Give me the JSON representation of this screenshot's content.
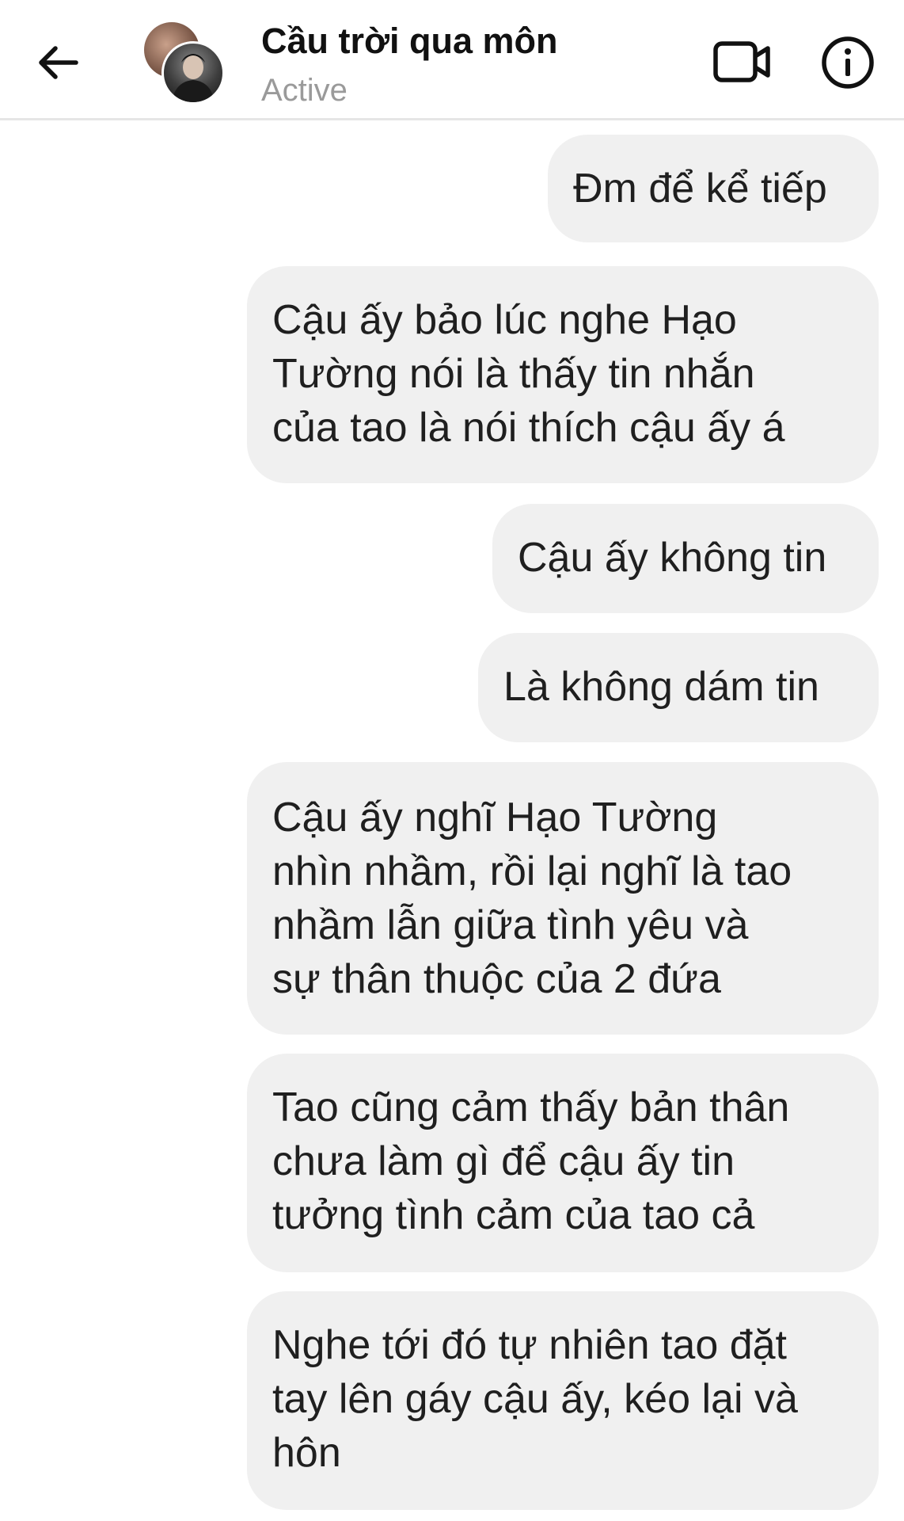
{
  "header": {
    "title": "Cầu trời qua môn",
    "status": "Active",
    "icons": {
      "back": "arrow-left-icon",
      "video": "video-camera-icon",
      "info": "info-circle-icon"
    }
  },
  "messages": [
    {
      "sender": "me",
      "text": "Đm để kể tiếp"
    },
    {
      "sender": "me",
      "text": "Cậu ấy bảo lúc nghe Hạo\nTường nói là thấy tin nhắn\ncủa tao là nói thích cậu ấy á"
    },
    {
      "sender": "me",
      "text": "Cậu ấy không tin"
    },
    {
      "sender": "me",
      "text": "Là không dám tin"
    },
    {
      "sender": "me",
      "text": "Cậu ấy nghĩ Hạo Tường\nnhìn nhầm, rồi lại nghĩ là tao\nnhầm lẫn giữa tình yêu và\nsự thân thuộc của 2 đứa"
    },
    {
      "sender": "me",
      "text": "Tao cũng cảm thấy bản thân\nchưa làm gì để cậu ấy tin\ntưởng tình cảm của tao cả"
    },
    {
      "sender": "me",
      "text": "Nghe tới đó tự nhiên tao đặt\ntay lên gáy cậu ấy, kéo lại và\nhôn"
    }
  ],
  "colors": {
    "bubble_bg": "#f0f0f0",
    "text": "#1f1f1f",
    "status": "#9a9a9a"
  }
}
